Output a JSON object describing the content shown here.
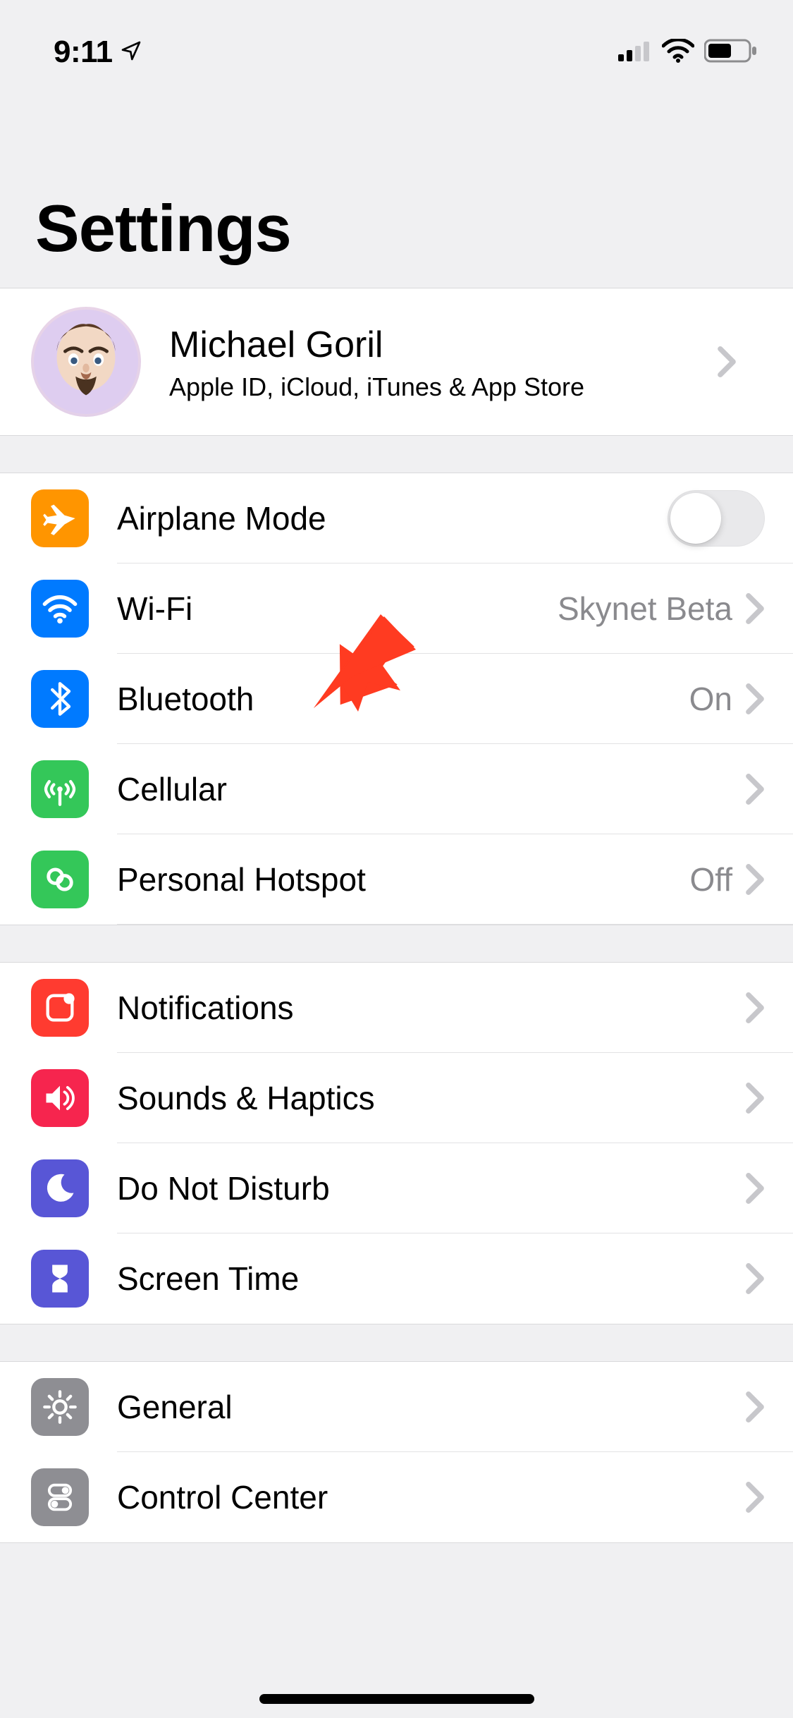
{
  "status": {
    "time": "9:11",
    "location_icon": "location-icon",
    "signal_bars": 2,
    "wifi_bars": 3,
    "battery_pct": 55
  },
  "title": "Settings",
  "account": {
    "name": "Michael Goril",
    "subtitle": "Apple ID, iCloud, iTunes & App Store"
  },
  "groups": [
    {
      "id": "connectivity",
      "rows": [
        {
          "id": "airplane",
          "icon": "airplane-icon",
          "icon_bg": "bg-orange",
          "label": "Airplane Mode",
          "control": "toggle",
          "toggle_on": false
        },
        {
          "id": "wifi",
          "icon": "wifi-icon",
          "icon_bg": "bg-blue",
          "label": "Wi-Fi",
          "control": "disclosure",
          "detail": "Skynet Beta"
        },
        {
          "id": "bluetooth",
          "icon": "bluetooth-icon",
          "icon_bg": "bg-blue",
          "label": "Bluetooth",
          "control": "disclosure",
          "detail": "On"
        },
        {
          "id": "cellular",
          "icon": "cellular-icon",
          "icon_bg": "bg-green",
          "label": "Cellular",
          "control": "disclosure",
          "detail": ""
        },
        {
          "id": "hotspot",
          "icon": "hotspot-icon",
          "icon_bg": "bg-green",
          "label": "Personal Hotspot",
          "control": "disclosure",
          "detail": "Off"
        }
      ]
    },
    {
      "id": "alerts",
      "rows": [
        {
          "id": "notifications",
          "icon": "notifications-icon",
          "icon_bg": "bg-red",
          "label": "Notifications",
          "control": "disclosure",
          "detail": ""
        },
        {
          "id": "sounds",
          "icon": "sounds-icon",
          "icon_bg": "bg-pink",
          "label": "Sounds & Haptics",
          "control": "disclosure",
          "detail": ""
        },
        {
          "id": "dnd",
          "icon": "dnd-icon",
          "icon_bg": "bg-indigo",
          "label": "Do Not Disturb",
          "control": "disclosure",
          "detail": ""
        },
        {
          "id": "screentime",
          "icon": "screentime-icon",
          "icon_bg": "bg-indigo",
          "label": "Screen Time",
          "control": "disclosure",
          "detail": ""
        }
      ]
    },
    {
      "id": "general_group",
      "rows": [
        {
          "id": "general",
          "icon": "gear-icon",
          "icon_bg": "bg-gray",
          "label": "General",
          "control": "disclosure",
          "detail": ""
        },
        {
          "id": "controlcenter",
          "icon": "controlcenter-icon",
          "icon_bg": "bg-gray",
          "label": "Control Center",
          "control": "disclosure",
          "detail": ""
        }
      ]
    }
  ],
  "annotation": {
    "target_row": "bluetooth",
    "color": "#ff3b21"
  }
}
